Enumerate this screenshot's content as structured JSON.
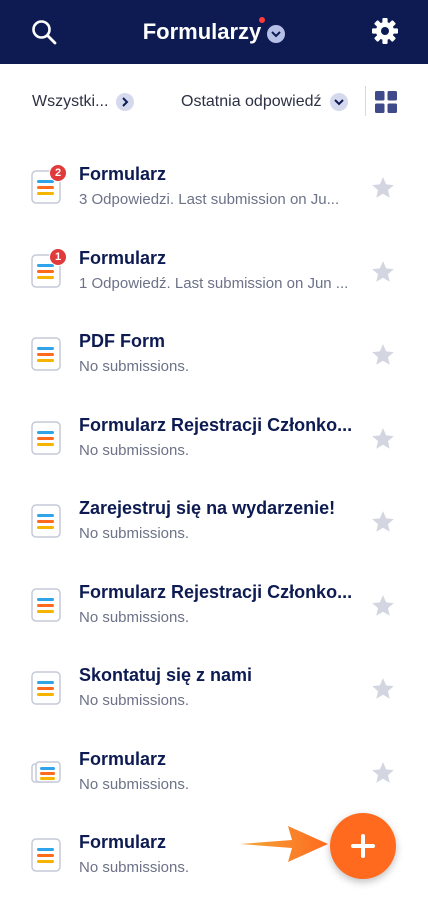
{
  "header": {
    "title": "Formularzy",
    "icons": {
      "search": "search-icon",
      "settings": "gear-icon",
      "title_dropdown": "chevron-down-icon"
    },
    "notification_dot_color": "#ff3b3b",
    "background": "#0d1b52"
  },
  "filter": {
    "folder_label": "Wszystki...",
    "sort_label": "Ostatnia odpowiedź",
    "view_icon": "grid-view-icon"
  },
  "forms": [
    {
      "title": "Formularz",
      "subtitle": "3 Odpowiedzi. Last submission on Ju...",
      "badge": "2",
      "starred": false
    },
    {
      "title": "Formularz",
      "subtitle": "1 Odpowiedź. Last submission on Jun ...",
      "badge": "1",
      "starred": false
    },
    {
      "title": "PDF Form",
      "subtitle": "No submissions.",
      "badge": null,
      "starred": false
    },
    {
      "title": "Formularz Rejestracji Członko...",
      "subtitle": "No submissions.",
      "badge": null,
      "starred": false
    },
    {
      "title": "Zarejestruj się na wydarzenie!",
      "subtitle": "No submissions.",
      "badge": null,
      "starred": false
    },
    {
      "title": "Formularz Rejestracji Członko...",
      "subtitle": "No submissions.",
      "badge": null,
      "starred": false
    },
    {
      "title": "Skontatuj się z nami",
      "subtitle": "No submissions.",
      "badge": null,
      "starred": false
    },
    {
      "title": "Formularz",
      "subtitle": "No submissions.",
      "badge": null,
      "starred": false
    },
    {
      "title": "Formularz",
      "subtitle": "No submissions.",
      "badge": null,
      "starred": false
    }
  ],
  "fab": {
    "icon": "plus-icon",
    "color": "#ff6a1f"
  },
  "annotation": {
    "icon": "orange-arrow-icon"
  },
  "colors": {
    "accent": "#ff6a1f",
    "badge": "#e03a3a",
    "text_primary": "#0d1b52",
    "text_secondary": "#6c7287"
  }
}
